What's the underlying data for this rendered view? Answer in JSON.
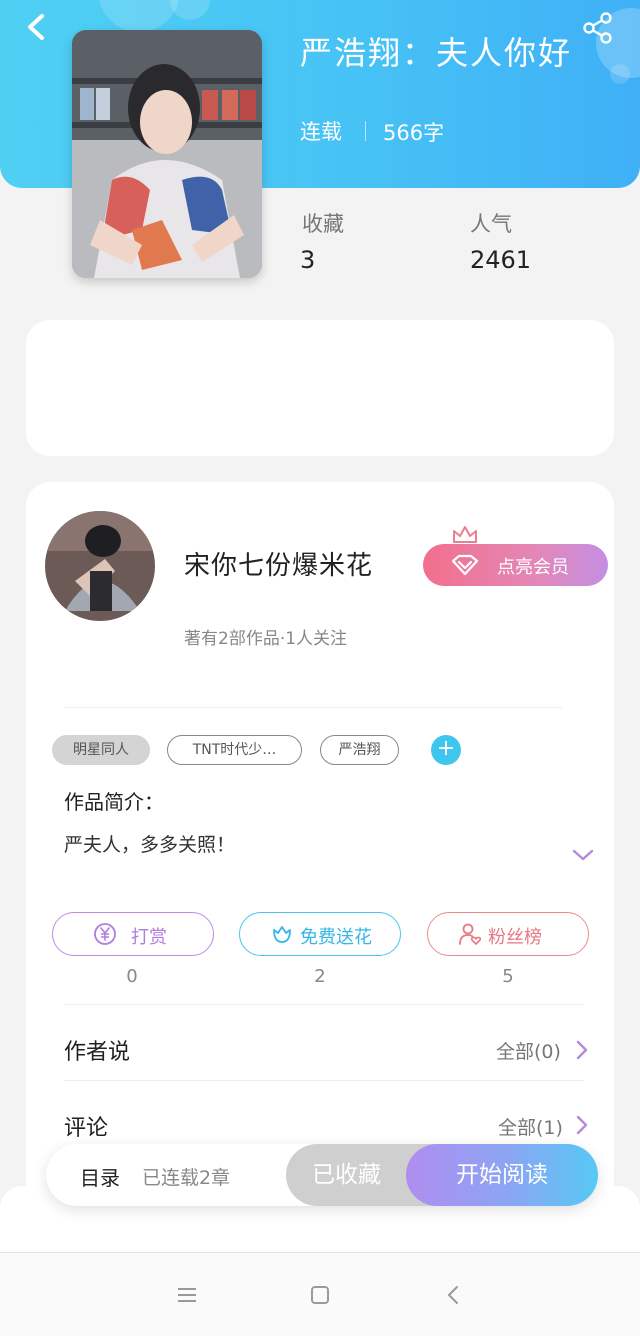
{
  "header": {
    "title": "严浩翔：夫人你好",
    "status": "连载",
    "word_count": "566字"
  },
  "stats": [
    {
      "label": "收藏",
      "value": "3"
    },
    {
      "label": "人气",
      "value": "2461"
    }
  ],
  "author": {
    "name": "宋你七份爆米花",
    "meta": "著有2部作品·1人关注",
    "vip_label": "点亮会员"
  },
  "tags": [
    "明星同人",
    "TNT时代少…",
    "严浩翔"
  ],
  "intro": {
    "label": "作品简介：",
    "text": "严夫人，多多关照！"
  },
  "actions": [
    {
      "label": "打赏",
      "count": "0",
      "icon": "yuan-coin-icon"
    },
    {
      "label": "免费送花",
      "count": "2",
      "icon": "flower-icon"
    },
    {
      "label": "粉丝榜",
      "count": "5",
      "icon": "user-heart-icon"
    }
  ],
  "sections": {
    "author_says": {
      "label": "作者说",
      "link": "全部(0)"
    },
    "comments": {
      "label": "评论",
      "link": "全部(1)"
    }
  },
  "bottom_bar": {
    "toc_label": "目录",
    "chapters": "已连载2章",
    "collected_label": "已收藏",
    "read_label": "开始阅读"
  },
  "colors": {
    "header_blue": "#47c2f5",
    "vip_gradient_start": "#f26f8c",
    "vip_gradient_end": "#c48ee3",
    "read_gradient_start": "#b08df0",
    "read_gradient_end": "#56c9f4"
  }
}
